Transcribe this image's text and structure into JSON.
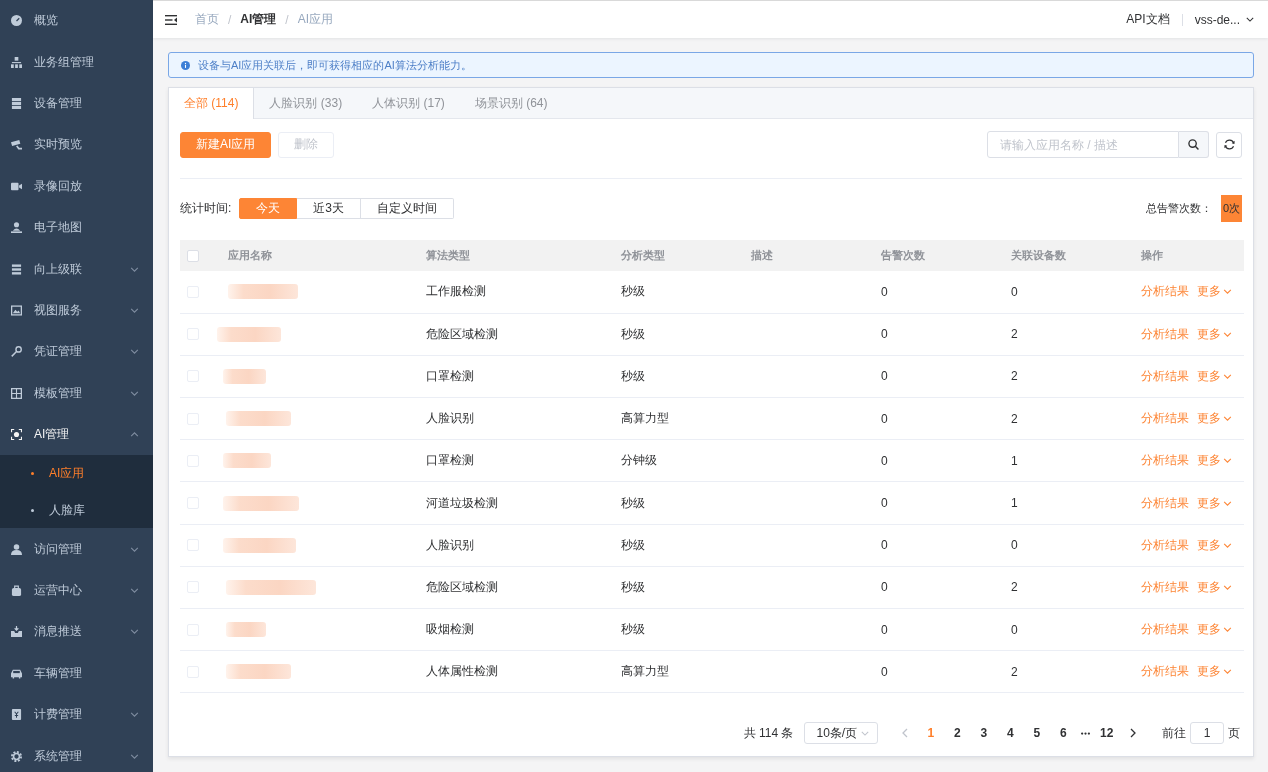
{
  "sidebar": {
    "items": [
      {
        "label": "概览",
        "selected": false
      },
      {
        "label": "业务组管理",
        "selected": false
      },
      {
        "label": "设备管理",
        "selected": false
      },
      {
        "label": "实时预览",
        "selected": false
      },
      {
        "label": "录像回放",
        "selected": false
      },
      {
        "label": "电子地图",
        "selected": false
      },
      {
        "label": "向上级联",
        "selected": false,
        "expanded": false
      },
      {
        "label": "视图服务",
        "selected": false,
        "expanded": false
      },
      {
        "label": "凭证管理",
        "selected": false,
        "expanded": false
      },
      {
        "label": "模板管理",
        "selected": false,
        "expanded": false
      },
      {
        "label": "AI管理",
        "selected": false,
        "expanded": true,
        "children": [
          {
            "label": "AI应用",
            "selected": true
          },
          {
            "label": "人脸库",
            "selected": false
          }
        ]
      },
      {
        "label": "访问管理",
        "selected": false,
        "expanded": false
      },
      {
        "label": "运营中心",
        "selected": false,
        "expanded": false
      },
      {
        "label": "消息推送",
        "selected": false,
        "expanded": false
      },
      {
        "label": "车辆管理",
        "selected": false
      },
      {
        "label": "计费管理",
        "selected": false,
        "expanded": false
      },
      {
        "label": "系统管理",
        "selected": false,
        "expanded": false
      }
    ]
  },
  "topbar": {
    "breadcrumb": [
      {
        "label": "首页",
        "kind": "text"
      },
      {
        "label": "AI管理",
        "kind": "link",
        "separator": "/"
      },
      {
        "label": "AI应用",
        "kind": "text",
        "separator": "/"
      }
    ],
    "api_link": "API文档",
    "user": "vss-de..."
  },
  "alert": {
    "text": "设备与AI应用关联后，即可获得相应的AI算法分析能力。"
  },
  "tabs": [
    {
      "label": "全部 (114)",
      "selected": true
    },
    {
      "label": "人脸识别 (33)",
      "selected": false
    },
    {
      "label": "人体识别 (17)",
      "selected": false
    },
    {
      "label": "场景识别 (64)",
      "selected": false
    }
  ],
  "toolbar": {
    "buttons": [
      {
        "label": "新建AI应用",
        "kind": "primary",
        "disabled": false
      },
      {
        "label": "删除",
        "kind": "default",
        "disabled": true
      }
    ],
    "search": {
      "placeholder": "请输入应用名称 / 描述"
    }
  },
  "stats": {
    "label": "统计时间:",
    "ranges": [
      {
        "label": "今天",
        "selected": true
      },
      {
        "label": "近3天",
        "selected": false
      },
      {
        "label": "自定义时间",
        "selected": false
      }
    ],
    "total_label": "总告警次数：",
    "total_value": "0次"
  },
  "table": {
    "select_all": {
      "checked": false
    },
    "columns": [
      "应用名称",
      "算法类型",
      "分析类型",
      "描述",
      "告警次数",
      "关联设备数",
      "操作"
    ],
    "rows": [
      {
        "checked": false,
        "algorithm": "工作服检测",
        "analysis": "秒级",
        "alarms": "0",
        "devices": "0",
        "actions": [
          {
            "label": "分析结果",
            "kind": "link"
          },
          {
            "label": "更多",
            "kind": "dropdown"
          }
        ]
      },
      {
        "checked": false,
        "algorithm": "危险区域检测",
        "analysis": "秒级",
        "alarms": "0",
        "devices": "2",
        "actions": [
          {
            "label": "分析结果",
            "kind": "link"
          },
          {
            "label": "更多",
            "kind": "dropdown"
          }
        ]
      },
      {
        "checked": false,
        "algorithm": "口罩检测",
        "analysis": "秒级",
        "alarms": "0",
        "devices": "2",
        "actions": [
          {
            "label": "分析结果",
            "kind": "link"
          },
          {
            "label": "更多",
            "kind": "dropdown"
          }
        ]
      },
      {
        "checked": false,
        "algorithm": "人脸识别",
        "analysis": "高算力型",
        "alarms": "0",
        "devices": "2",
        "actions": [
          {
            "label": "分析结果",
            "kind": "link"
          },
          {
            "label": "更多",
            "kind": "dropdown"
          }
        ]
      },
      {
        "checked": false,
        "algorithm": "口罩检测",
        "analysis": "分钟级",
        "alarms": "0",
        "devices": "1",
        "actions": [
          {
            "label": "分析结果",
            "kind": "link"
          },
          {
            "label": "更多",
            "kind": "dropdown"
          }
        ]
      },
      {
        "checked": false,
        "algorithm": "河道垃圾检测",
        "analysis": "秒级",
        "alarms": "0",
        "devices": "1",
        "actions": [
          {
            "label": "分析结果",
            "kind": "link"
          },
          {
            "label": "更多",
            "kind": "dropdown"
          }
        ]
      },
      {
        "checked": false,
        "algorithm": "人脸识别",
        "analysis": "秒级",
        "alarms": "0",
        "devices": "0",
        "actions": [
          {
            "label": "分析结果",
            "kind": "link"
          },
          {
            "label": "更多",
            "kind": "dropdown"
          }
        ]
      },
      {
        "checked": false,
        "algorithm": "危险区域检测",
        "analysis": "秒级",
        "alarms": "0",
        "devices": "2",
        "actions": [
          {
            "label": "分析结果",
            "kind": "link"
          },
          {
            "label": "更多",
            "kind": "dropdown"
          }
        ]
      },
      {
        "checked": false,
        "algorithm": "吸烟检测",
        "analysis": "秒级",
        "alarms": "0",
        "devices": "0",
        "actions": [
          {
            "label": "分析结果",
            "kind": "link"
          },
          {
            "label": "更多",
            "kind": "dropdown"
          }
        ]
      },
      {
        "checked": false,
        "algorithm": "人体属性检测",
        "analysis": "高算力型",
        "alarms": "0",
        "devices": "2",
        "actions": [
          {
            "label": "分析结果",
            "kind": "link"
          },
          {
            "label": "更多",
            "kind": "dropdown"
          }
        ]
      }
    ]
  },
  "pagination": {
    "total": "共 114 条",
    "page_size": "10条/页",
    "previous_disabled": true,
    "next_disabled": false,
    "pages": [
      {
        "kind": "page",
        "label": "1",
        "selected": true
      },
      {
        "kind": "page",
        "label": "2",
        "selected": false
      },
      {
        "kind": "page",
        "label": "3",
        "selected": false
      },
      {
        "kind": "page",
        "label": "4",
        "selected": false
      },
      {
        "kind": "page",
        "label": "5",
        "selected": false
      },
      {
        "kind": "page",
        "label": "6",
        "selected": false
      },
      {
        "kind": "more"
      },
      {
        "kind": "page",
        "label": "12",
        "selected": false
      }
    ],
    "jump": {
      "label": "前往",
      "value": "1",
      "suffix": "页"
    }
  }
}
